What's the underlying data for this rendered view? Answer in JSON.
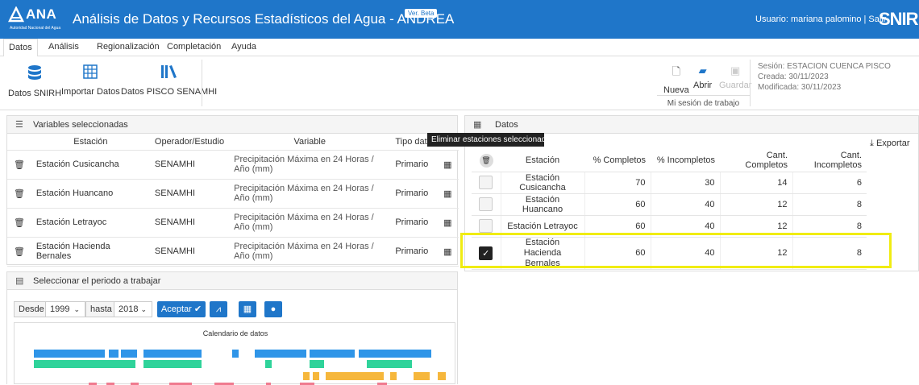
{
  "header": {
    "logo_text": "ANA",
    "logo_sub": "Autoridad Nacional del Agua",
    "title": "Análisis de Datos y Recursos Estadísticos del Agua - ANDREA",
    "beta": "Ver. Beta",
    "user": "Usuario: mariana palomino | Salir",
    "snirh": "SNIR"
  },
  "menu": [
    "Datos",
    "Análisis",
    "Regionalización",
    "Completación",
    "Ayuda"
  ],
  "ribbon": {
    "buttons": [
      {
        "label": "Datos SNIRH",
        "icon": "database-icon"
      },
      {
        "label": "Importar Datos",
        "icon": "table-icon"
      },
      {
        "label": "Datos PISCO SENAMHI",
        "icon": "library-icon"
      }
    ],
    "session_buttons": [
      {
        "label": "Nueva",
        "icon": "new-file-icon"
      },
      {
        "label": "Abrir",
        "icon": "folder-open-icon"
      },
      {
        "label": "Guardar",
        "icon": "save-icon"
      }
    ],
    "session_group": "Mi sesión de trabajo",
    "session_name": "Sesión: ESTACION CUENCA PISCO",
    "created": "Creada: 30/11/2023",
    "modified": "Modificada: 30/11/2023"
  },
  "variables_panel": {
    "title": "Variables seleccionadas",
    "columns": [
      "Estación",
      "Operador/Estudio",
      "Variable",
      "Tipo dato"
    ],
    "rows": [
      {
        "station": "Estación Cusicancha",
        "operator": "SENAMHI",
        "variable": "Precipitación Máxima en 24 Horas / Año (mm)",
        "type": "Primario"
      },
      {
        "station": "Estación Huancano",
        "operator": "SENAMHI",
        "variable": "Precipitación Máxima en 24 Horas / Año (mm)",
        "type": "Primario"
      },
      {
        "station": "Estación Letrayoc",
        "operator": "SENAMHI",
        "variable": "Precipitación Máxima en 24 Horas / Año (mm)",
        "type": "Primario"
      },
      {
        "station": "Estación Hacienda Bernales",
        "operator": "SENAMHI",
        "variable": "Precipitación Máxima en 24 Horas / Año (mm)",
        "type": "Primario"
      }
    ]
  },
  "tooltip": "Eliminar estaciones seleccionadas",
  "data_panel": {
    "title": "Datos",
    "export": "Exportar",
    "columns": [
      "Estación",
      "% Completos",
      "% Incompletos",
      "Cant. Completos",
      "Cant. Incompletos"
    ],
    "rows": [
      {
        "station": "Estación Cusicancha",
        "pc": "70",
        "pi": "30",
        "cc": "14",
        "ci": "6",
        "checked": false
      },
      {
        "station": "Estación Huancano",
        "pc": "60",
        "pi": "40",
        "cc": "12",
        "ci": "8",
        "checked": false
      },
      {
        "station": "Estación Letrayoc",
        "pc": "60",
        "pi": "40",
        "cc": "12",
        "ci": "8",
        "checked": false
      },
      {
        "station": "Estación Hacienda Bernales",
        "pc": "60",
        "pi": "40",
        "cc": "12",
        "ci": "8",
        "checked": true
      }
    ]
  },
  "period_panel": {
    "title": "Seleccionar el periodo a trabajar",
    "desde_label": "Desde",
    "desde_value": "1999",
    "hasta_label": "hasta",
    "hasta_value": "2018",
    "accept": "Aceptar",
    "chart_title": "Calendario de datos"
  },
  "colors": {
    "primary": "#1f76c9",
    "highlight": "#f0ec12",
    "series1": "#2f95e8",
    "series2": "#2fd39a",
    "series3": "#f6b73c",
    "series4": "#f07b8f"
  }
}
